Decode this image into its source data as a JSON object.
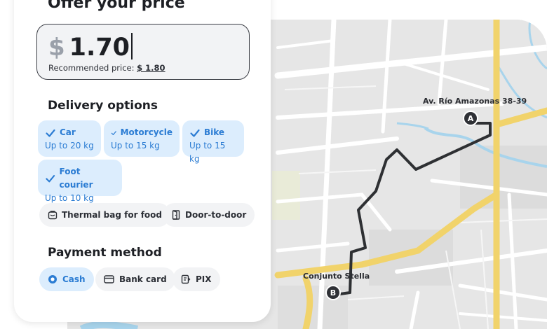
{
  "offer": {
    "title": "Offer your price",
    "currency": "$",
    "amount": "1.70",
    "recommended_label": "Recommended price:",
    "recommended_value": "$ 1.80"
  },
  "delivery": {
    "title": "Delivery options",
    "options": [
      {
        "label": "Car",
        "capacity": "Up to 20 kg",
        "selected": true
      },
      {
        "label": "Motorcycle",
        "capacity": "Up to 15 kg",
        "selected": true
      },
      {
        "label": "Bike",
        "capacity": "Up to 15 kg",
        "selected": true
      },
      {
        "label": "Foot courier",
        "capacity": "Up to 10 kg",
        "selected": true
      }
    ],
    "extras": [
      {
        "label": "Thermal bag for food",
        "icon": "thermal-bag-icon"
      },
      {
        "label": "Door-to-door",
        "icon": "door-icon"
      }
    ]
  },
  "payment": {
    "title": "Payment method",
    "methods": [
      {
        "label": "Cash",
        "icon": "radio-selected-icon",
        "selected": true
      },
      {
        "label": "Bank card",
        "icon": "card-icon",
        "selected": false
      },
      {
        "label": "PIX",
        "icon": "pix-icon",
        "selected": false
      }
    ]
  },
  "map": {
    "pickup_label": "Av. Río Amazonas 38-39",
    "pickup_marker": "A",
    "dropoff_label": "Conjunto Stella",
    "dropoff_marker": "B"
  },
  "colors": {
    "accent": "#2b7cd3",
    "chip_bg": "#dcedfd",
    "route": "#2e3033",
    "road_major": "#f1d36b",
    "water": "#a8d4ec"
  }
}
